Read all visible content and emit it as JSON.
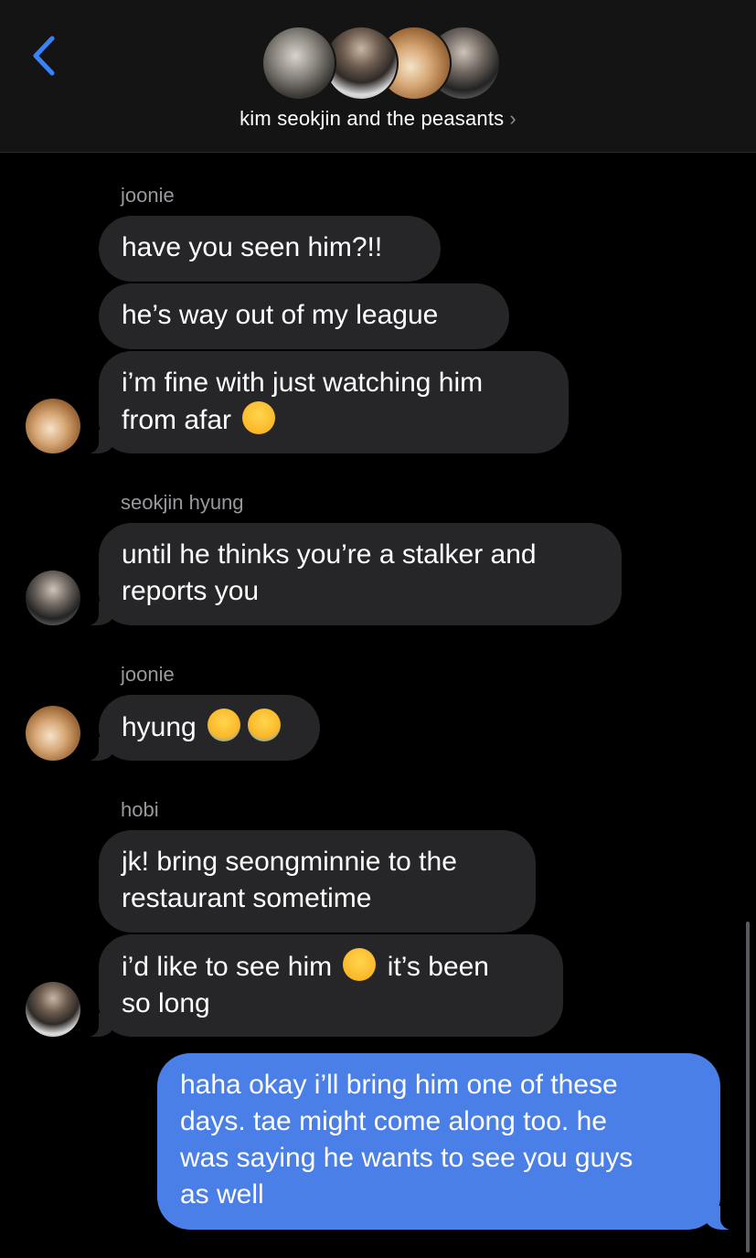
{
  "header": {
    "back_label": "Back",
    "group_name": "kim seokjin and the peasants",
    "chevron": "›",
    "avatars": [
      "jungkook-avatar",
      "yoongi-avatar",
      "namjoon-avatar",
      "seokjin-avatar"
    ]
  },
  "messages": [
    {
      "sender": "joonie",
      "texts": [
        "have you seen him?!!",
        "he’s way out of my league",
        "i’m fine with just watching him",
        "from afar"
      ],
      "emoji": "steam-from-nose-emoji"
    },
    {
      "sender": "seokjin hyung",
      "texts": [
        "until he thinks you’re a stalker and",
        "reports you"
      ]
    },
    {
      "sender": "joonie",
      "texts": [
        "hyung"
      ],
      "emoji": "loudly-crying-emoji"
    },
    {
      "sender": "hobi",
      "texts": [
        "jk! bring seongminnie to the",
        "restaurant sometime",
        "i’d like to see him",
        "it’s been",
        "so long"
      ],
      "emoji": "face-holding-back-tears-emoji"
    },
    {
      "sender": "me",
      "texts": [
        "haha okay i’ll bring him one of these",
        "days. tae might come along too. he",
        "was saying he wants to see you guys",
        "as well"
      ]
    }
  ],
  "colors": {
    "incoming_bubble": "#262628",
    "outgoing_bubble": "#4a7fe8",
    "accent": "#3a82f7",
    "sender_label": "#98989d"
  }
}
